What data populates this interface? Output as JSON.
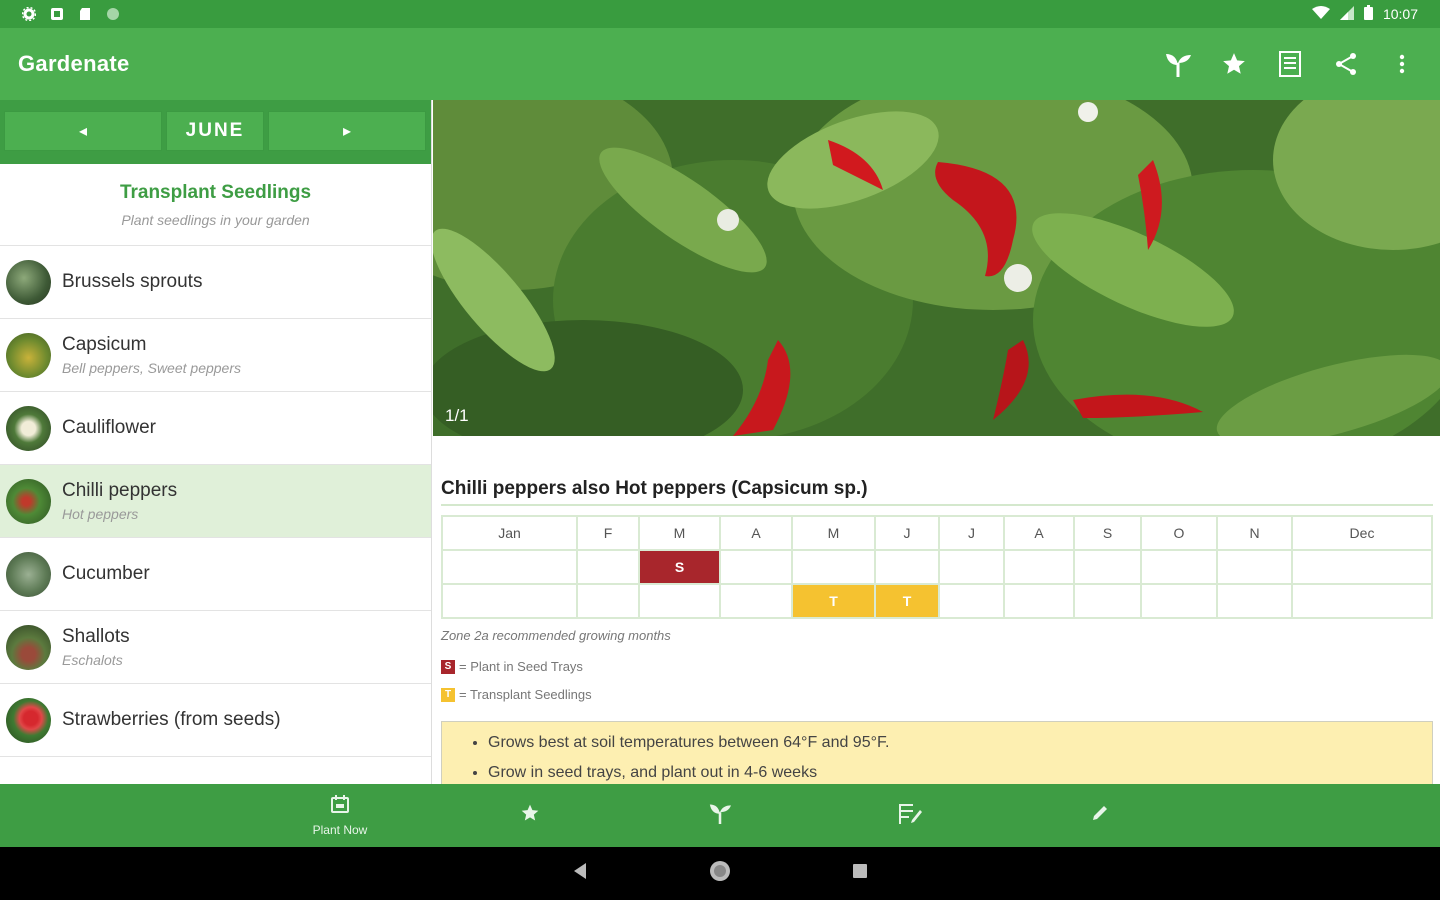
{
  "status_bar": {
    "time": "10:07"
  },
  "app_bar": {
    "title": "Gardenate"
  },
  "month_nav": {
    "prev": "◂",
    "current": "JUNE",
    "next": "▸"
  },
  "section": {
    "title": "Transplant Seedlings",
    "subtitle": "Plant seedlings in your garden"
  },
  "plants": [
    {
      "name": "Brussels sprouts",
      "alias": ""
    },
    {
      "name": "Capsicum",
      "alias": "Bell peppers, Sweet peppers"
    },
    {
      "name": "Cauliflower",
      "alias": ""
    },
    {
      "name": "Chilli peppers",
      "alias": "Hot peppers"
    },
    {
      "name": "Cucumber",
      "alias": ""
    },
    {
      "name": "Shallots",
      "alias": "Eschalots"
    },
    {
      "name": "Strawberries (from seeds)",
      "alias": ""
    }
  ],
  "detail": {
    "image_counter": "1/1",
    "title": "Chilli peppers also Hot peppers (Capsicum sp.)",
    "months": [
      "Jan",
      "F",
      "M",
      "A",
      "M",
      "J",
      "J",
      "A",
      "S",
      "O",
      "N",
      "Dec"
    ],
    "sow_marker": "S",
    "transplant_marker": "T",
    "zone_note": "Zone 2a recommended growing months",
    "legend_s": "= Plant in Seed Trays",
    "legend_t": "= Transplant Seedlings",
    "tips": [
      "Grows best at soil temperatures between 64°F and 95°F.",
      "Grow in seed trays, and plant out in 4-6 weeks"
    ]
  },
  "bottom_nav": {
    "plant_now": "Plant Now"
  },
  "colors": {
    "primary": "#4caf50",
    "dark": "#3e9d44",
    "sow": "#a8262c",
    "transplant": "#f5c230",
    "tips_bg": "#fdefb1"
  }
}
